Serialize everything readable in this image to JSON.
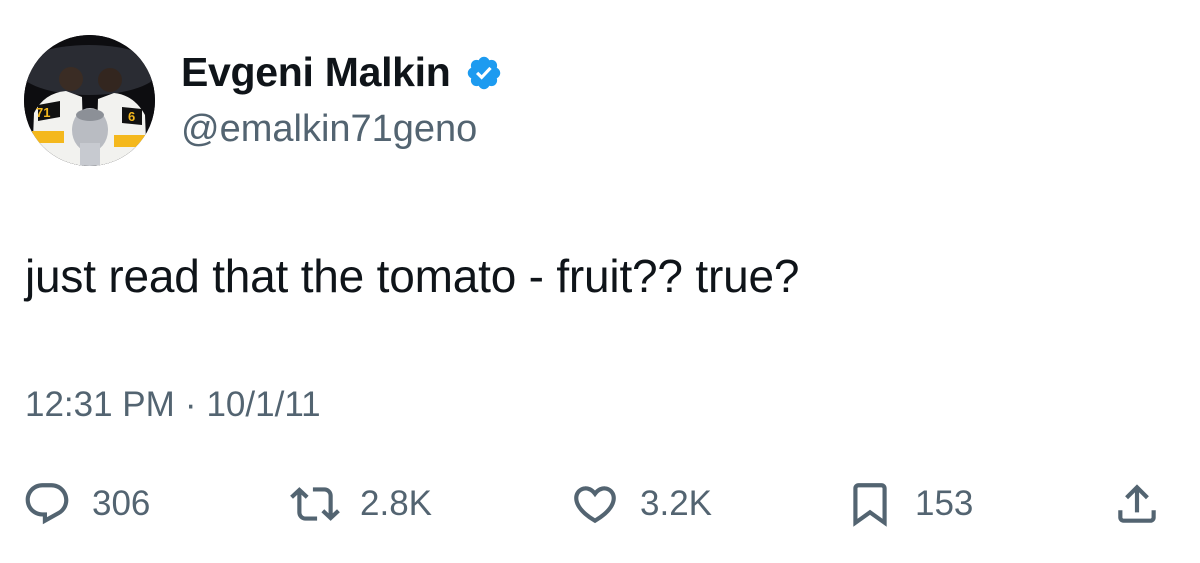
{
  "user": {
    "display_name": "Evgeni Malkin",
    "handle": "@emalkin71geno",
    "verified": true,
    "avatar_jersey_numbers": [
      "71",
      "6"
    ]
  },
  "tweet": {
    "text": "just read that the tomato - fruit?? true?",
    "time": "12:31 PM",
    "separator": "·",
    "date": "10/1/11"
  },
  "actions": {
    "reply": {
      "icon": "reply-icon",
      "count": "306"
    },
    "retweet": {
      "icon": "retweet-icon",
      "count": "2.8K"
    },
    "like": {
      "icon": "heart-icon",
      "count": "3.2K"
    },
    "bookmark": {
      "icon": "bookmark-icon",
      "count": "153"
    },
    "share": {
      "icon": "share-icon"
    }
  },
  "colors": {
    "text": "#0f1419",
    "secondary": "#536471",
    "verified": "#1d9bf0",
    "icon": "#536471"
  }
}
